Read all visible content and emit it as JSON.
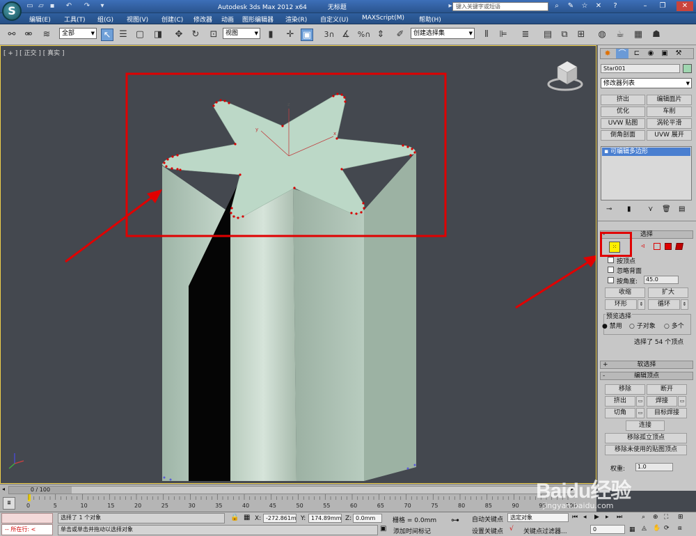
{
  "titlebar": {
    "app_title": "Autodesk 3ds Max  2012 x64",
    "doc_title": "无标题",
    "search_placeholder": "键入关键字或短语",
    "logo": "S"
  },
  "menubar": {
    "items": [
      "编辑(E)",
      "工具(T)",
      "组(G)",
      "视图(V)",
      "创建(C)",
      "修改器",
      "动画",
      "图形编辑器",
      "渲染(R)",
      "自定义(U)",
      "MAXScript(M)",
      "帮助(H)"
    ]
  },
  "toolbar": {
    "selection_filter": "全部",
    "ref_coord": "视图",
    "named_selection": "创建选择集",
    "snap_label": "3",
    "percent_label": "%"
  },
  "viewport": {
    "label": "[ + ] [ 正交 ] [ 真实 ]",
    "gizmo_x": "x",
    "gizmo_y": "y",
    "gizmo_z": "z"
  },
  "command_panel": {
    "object_name": "Star001",
    "modifier_list": "修改器列表",
    "modifier_buttons": [
      "挤出",
      "编辑面片",
      "优化",
      "车削",
      "UVW 贴图",
      "涡轮平滑",
      "倒角剖面",
      "UVW 展开"
    ],
    "stack_item": "可编辑多边形",
    "selection": {
      "title": "选择",
      "by_vertex": "按顶点",
      "ignore_backfacing": "忽略背面",
      "by_angle": "按角度:",
      "angle_value": "45.0",
      "shrink": "收缩",
      "grow": "扩大",
      "ring": "环形",
      "loop": "循环",
      "preview_title": "预览选择",
      "preview_off": "禁用",
      "preview_sub": "子对象",
      "preview_multi": "多个",
      "status": "选择了 54 个顶点"
    },
    "soft_selection_title": "软选择",
    "edit_vertices": {
      "title": "编辑顶点",
      "remove": "移除",
      "break": "断开",
      "extrude": "挤出",
      "weld": "焊接",
      "chamfer": "切角",
      "target_weld": "目标焊接",
      "connect": "连接",
      "remove_isolated": "移除孤立顶点",
      "remove_unused_map": "移除未使用的贴图顶点",
      "weight_label": "权重:",
      "weight_value": "1.0"
    }
  },
  "timeline": {
    "frame_counter": "0 / 100",
    "ticks": [
      "0",
      "5",
      "10",
      "15",
      "20",
      "25",
      "30",
      "35",
      "40",
      "45",
      "50",
      "55",
      "60",
      "65",
      "70",
      "75",
      "80",
      "85",
      "90",
      "95",
      "100"
    ]
  },
  "status": {
    "running_label": "所在行:",
    "selected_text": "选择了 1 个对象",
    "prompt_text": "单击或单击并拖动以选择对象",
    "x_label": "X:",
    "x_value": "-272.861m",
    "y_label": "Y:",
    "y_value": "174.89mm",
    "z_label": "Z:",
    "z_value": "0.0mm",
    "grid_text": "栅格 = 0.0mm",
    "add_time_tag": "添加时间标记",
    "auto_key": "自动关键点",
    "set_key": "设置关键点",
    "selected_object": "选定对象",
    "key_filters": "关键点过滤器...",
    "frame_value": "0"
  },
  "watermark": {
    "text": "Baidu经验",
    "url": "jingyan.baidu.com"
  },
  "colors": {
    "viewport_bg": "#44484f",
    "model_fill": "#b9d5c4",
    "annotation_red": "#e00000",
    "active_blue": "#4a7fd0",
    "title_blue": "#2f5f9e"
  }
}
